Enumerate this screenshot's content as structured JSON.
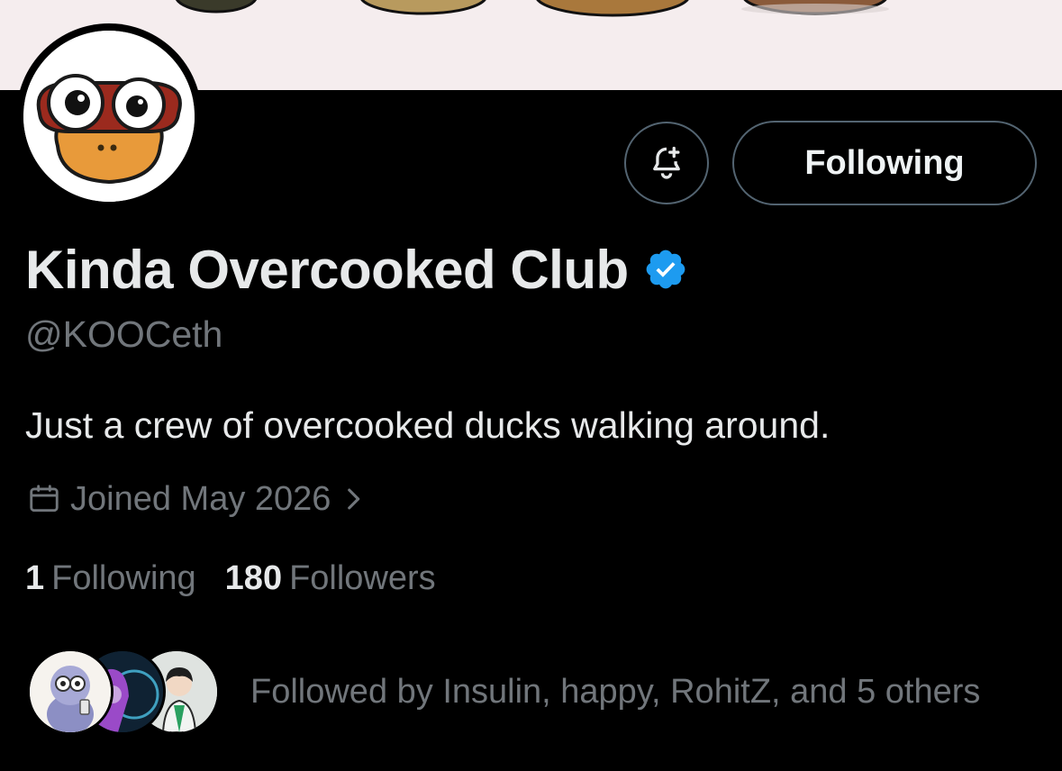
{
  "profile": {
    "display_name": "Kinda Overcooked Club",
    "handle": "@KOOCeth",
    "bio": "Just a crew of overcooked ducks walking around.",
    "joined": "Joined May 2026",
    "verified": true
  },
  "actions": {
    "notify_icon": "bell-plus-icon",
    "follow_label": "Following"
  },
  "stats": {
    "following_count": "1",
    "following_label": "Following",
    "followers_count": "180",
    "followers_label": "Followers"
  },
  "followed_by": {
    "text": "Followed by Insulin, happy, RohitZ, and 5 others"
  },
  "colors": {
    "background": "#000000",
    "primary_text": "#e7e9ea",
    "secondary_text": "#71767b",
    "border": "#536471",
    "verified_blue": "#1d9bf0",
    "banner": "#f5edee"
  }
}
